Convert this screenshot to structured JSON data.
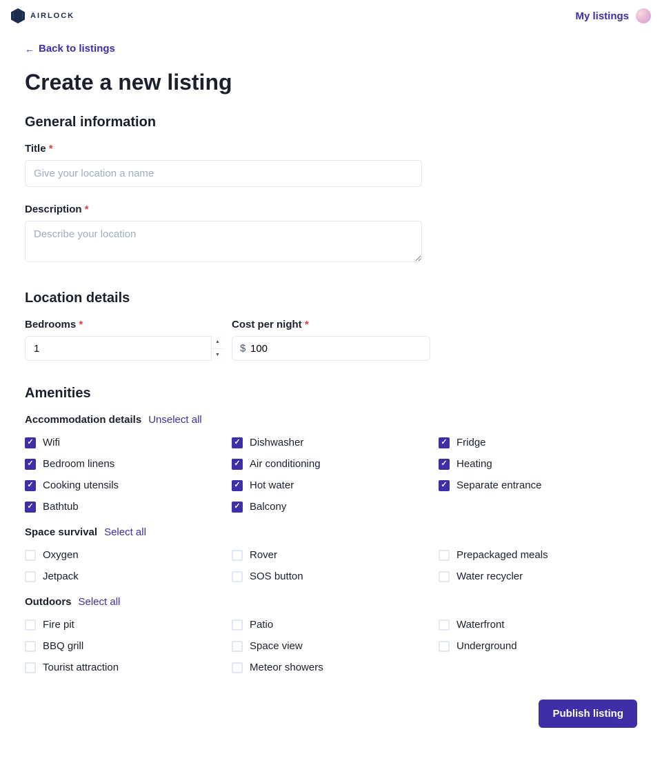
{
  "header": {
    "brand": "AIRLOCK",
    "my_listings": "My listings"
  },
  "back_link": "Back to listings",
  "page_title": "Create a new listing",
  "sections": {
    "general": {
      "title": "General information",
      "title_field": {
        "label": "Title",
        "placeholder": "Give your location a name",
        "value": ""
      },
      "description_field": {
        "label": "Description",
        "placeholder": "Describe your location",
        "value": ""
      }
    },
    "location": {
      "title": "Location details",
      "bedrooms": {
        "label": "Bedrooms",
        "value": "1"
      },
      "cost": {
        "label": "Cost per night",
        "prefix": "$",
        "value": "100"
      }
    },
    "amenities": {
      "title": "Amenities",
      "groups": [
        {
          "name": "Accommodation details",
          "action": "Unselect all",
          "items": [
            {
              "label": "Wifi",
              "checked": true
            },
            {
              "label": "Dishwasher",
              "checked": true
            },
            {
              "label": "Fridge",
              "checked": true
            },
            {
              "label": "Bedroom linens",
              "checked": true
            },
            {
              "label": "Air conditioning",
              "checked": true
            },
            {
              "label": "Heating",
              "checked": true
            },
            {
              "label": "Cooking utensils",
              "checked": true
            },
            {
              "label": "Hot water",
              "checked": true
            },
            {
              "label": "Separate entrance",
              "checked": true
            },
            {
              "label": "Bathtub",
              "checked": true
            },
            {
              "label": "Balcony",
              "checked": true
            }
          ]
        },
        {
          "name": "Space survival",
          "action": "Select all",
          "items": [
            {
              "label": "Oxygen",
              "checked": false
            },
            {
              "label": "Rover",
              "checked": false
            },
            {
              "label": "Prepackaged meals",
              "checked": false
            },
            {
              "label": "Jetpack",
              "checked": false
            },
            {
              "label": "SOS button",
              "checked": false
            },
            {
              "label": "Water recycler",
              "checked": false
            }
          ]
        },
        {
          "name": "Outdoors",
          "action": "Select all",
          "items": [
            {
              "label": "Fire pit",
              "checked": false
            },
            {
              "label": "Patio",
              "checked": false
            },
            {
              "label": "Waterfront",
              "checked": false
            },
            {
              "label": "BBQ grill",
              "checked": false
            },
            {
              "label": "Space view",
              "checked": false
            },
            {
              "label": "Underground",
              "checked": false
            },
            {
              "label": "Tourist attraction",
              "checked": false
            },
            {
              "label": "Meteor showers",
              "checked": false
            }
          ]
        }
      ]
    }
  },
  "publish_label": "Publish listing"
}
